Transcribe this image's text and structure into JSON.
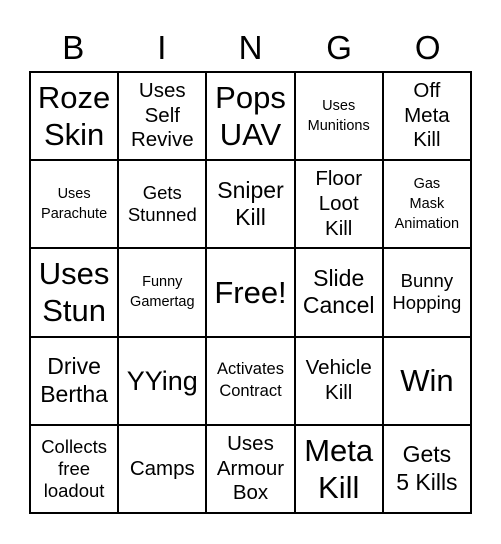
{
  "header": {
    "letters": [
      "B",
      "I",
      "N",
      "G",
      "O"
    ]
  },
  "grid": {
    "cells": [
      [
        "Roze\nSkin",
        "Uses\nSelf\nRevive",
        "Pops\nUAV",
        "Uses\nMunitions",
        "Off\nMeta\nKill"
      ],
      [
        "Uses\nParachute",
        "Gets\nStunned",
        "Sniper\nKill",
        "Floor\nLoot\nKill",
        "Gas\nMask\nAnimation"
      ],
      [
        "Uses\nStun",
        "Funny\nGamertag",
        "Free!",
        "Slide\nCancel",
        "Bunny\nHopping"
      ],
      [
        "Drive\nBertha",
        "YYing",
        "Activates\nContract",
        "Vehicle\nKill",
        "Win"
      ],
      [
        "Collects\nfree\nloadout",
        "Camps",
        "Uses\nArmour\nBox",
        "Meta\nKill",
        "Gets\n5 Kills"
      ]
    ]
  }
}
